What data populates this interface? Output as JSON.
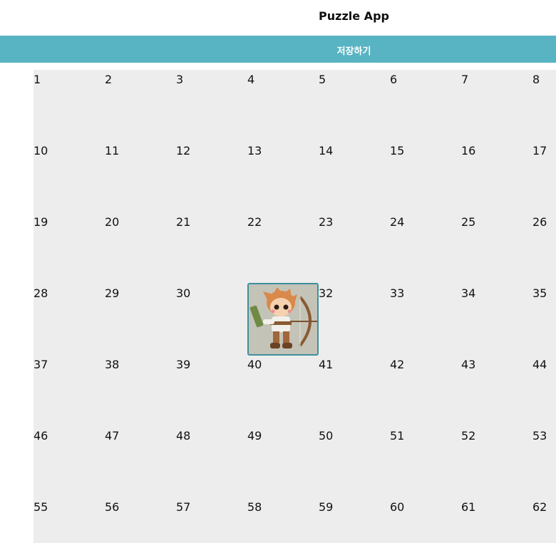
{
  "app": {
    "title": "Puzzle App",
    "save_label": "저장하기"
  },
  "board": {
    "rows": [
      [
        "1",
        "2",
        "3",
        "4",
        "5",
        "6",
        "7",
        "8"
      ],
      [
        "10",
        "11",
        "12",
        "13",
        "14",
        "15",
        "16",
        "17"
      ],
      [
        "19",
        "20",
        "21",
        "22",
        "23",
        "24",
        "25",
        "26"
      ],
      [
        "28",
        "29",
        "30",
        "",
        "32",
        "33",
        "34",
        "35"
      ],
      [
        "37",
        "38",
        "39",
        "40",
        "41",
        "42",
        "43",
        "44"
      ],
      [
        "46",
        "47",
        "48",
        "49",
        "50",
        "51",
        "52",
        "53"
      ],
      [
        "55",
        "56",
        "57",
        "58",
        "59",
        "60",
        "61",
        "62"
      ]
    ]
  },
  "piece": {
    "icon": "archer-character-icon",
    "colors": {
      "border": "#3f8f9d",
      "background": "#c4c3b8",
      "hair": "#d9894a",
      "bow": "#8a5a32"
    }
  },
  "colors": {
    "accent": "#58b4c2",
    "board_bg": "#ededed"
  }
}
